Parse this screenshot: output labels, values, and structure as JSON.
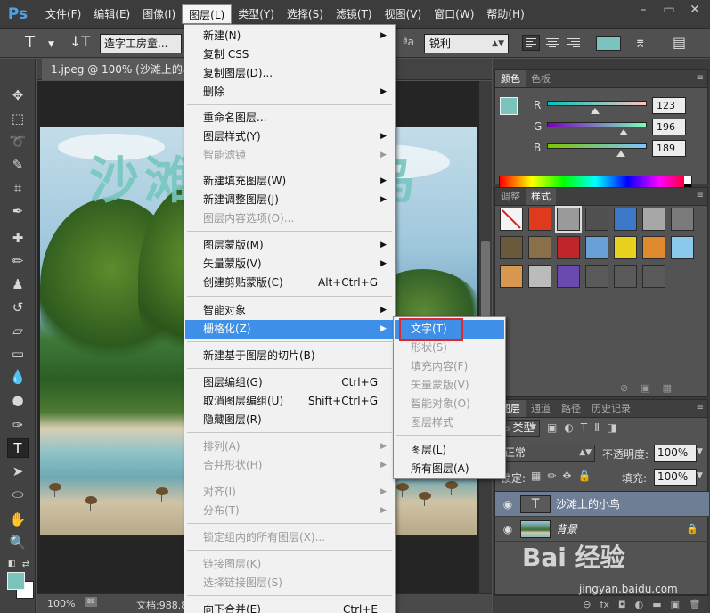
{
  "app": {
    "logo": "Ps"
  },
  "menubar": {
    "items": [
      "文件(F)",
      "编辑(E)",
      "图像(I)",
      "图层(L)",
      "类型(Y)",
      "选择(S)",
      "滤镜(T)",
      "视图(V)",
      "窗口(W)",
      "帮助(H)"
    ],
    "active": "图层(L)"
  },
  "window_controls": {
    "minimize": "–",
    "restore": "▭",
    "close": "✕"
  },
  "options_bar": {
    "tool_glyph": "T",
    "font_family": "造字工房童...",
    "aa_label": "ªa",
    "antialias": "锐利",
    "text_color": "#7bc4bd"
  },
  "document": {
    "tab_title": "1.jpeg @ 100% (沙滩上的小",
    "canvas_text": "沙滩上的小鸟",
    "zoom": "100%",
    "doc_info": "文档:988.8"
  },
  "layer_menu": {
    "items": [
      {
        "label": "新建(N)",
        "arrow": true
      },
      {
        "label": "复制 CSS"
      },
      {
        "label": "复制图层(D)..."
      },
      {
        "label": "删除",
        "arrow": true
      },
      {
        "label": "重命名图层..."
      },
      {
        "label": "图层样式(Y)",
        "arrow": true
      },
      {
        "label": "智能滤镜",
        "disabled": true,
        "arrow": true
      },
      {
        "label": "新建填充图层(W)",
        "arrow": true
      },
      {
        "label": "新建调整图层(J)",
        "arrow": true
      },
      {
        "label": "图层内容选项(O)...",
        "disabled": true
      },
      {
        "label": "图层蒙版(M)",
        "arrow": true
      },
      {
        "label": "矢量蒙版(V)",
        "arrow": true
      },
      {
        "label": "创建剪贴蒙版(C)",
        "shortcut": "Alt+Ctrl+G"
      },
      {
        "label": "智能对象",
        "arrow": true
      },
      {
        "label": "栅格化(Z)",
        "arrow": true,
        "highlighted": true
      },
      {
        "label": "新建基于图层的切片(B)"
      },
      {
        "label": "图层编组(G)",
        "shortcut": "Ctrl+G"
      },
      {
        "label": "取消图层编组(U)",
        "shortcut": "Shift+Ctrl+G"
      },
      {
        "label": "隐藏图层(R)"
      },
      {
        "label": "排列(A)",
        "disabled": true,
        "arrow": true
      },
      {
        "label": "合并形状(H)",
        "disabled": true,
        "arrow": true
      },
      {
        "label": "对齐(I)",
        "disabled": true,
        "arrow": true
      },
      {
        "label": "分布(T)",
        "disabled": true,
        "arrow": true
      },
      {
        "label": "锁定组内的所有图层(X)...",
        "disabled": true
      },
      {
        "label": "链接图层(K)",
        "disabled": true
      },
      {
        "label": "选择链接图层(S)",
        "disabled": true
      },
      {
        "label": "向下合并(E)",
        "shortcut": "Ctrl+E"
      }
    ]
  },
  "rasterize_submenu": {
    "items": [
      {
        "label": "文字(T)",
        "highlighted": true
      },
      {
        "label": "形状(S)",
        "disabled": true
      },
      {
        "label": "填充内容(F)",
        "disabled": true
      },
      {
        "label": "矢量蒙版(V)",
        "disabled": true
      },
      {
        "label": "智能对象(O)",
        "disabled": true
      },
      {
        "label": "图层样式",
        "disabled": true
      },
      {
        "label": "图层(L)"
      },
      {
        "label": "所有图层(A)"
      }
    ]
  },
  "color_panel": {
    "tabs": [
      "颜色",
      "色板"
    ],
    "active_tab": "颜色",
    "swatch_color": "#7bc4bd",
    "channels": [
      {
        "name": "R",
        "value": "123",
        "fraction": 0.482,
        "gradient": "linear-gradient(90deg,#00c4bd,#ffc4bd)"
      },
      {
        "name": "G",
        "value": "196",
        "fraction": 0.769,
        "gradient": "linear-gradient(90deg,#7b00bd,#7bffbd)"
      },
      {
        "name": "B",
        "value": "189",
        "fraction": 0.741,
        "gradient": "linear-gradient(90deg,#7bc400,#7bc4ff)"
      }
    ]
  },
  "styles_panel": {
    "tabs": [
      "调整",
      "样式"
    ],
    "active_tab": "样式",
    "styles": [
      {
        "icon": "none-style-icon",
        "color": "#f4f4f4"
      },
      {
        "icon": "red-glow-style-icon",
        "color": "#e03a1e"
      },
      {
        "icon": "gray-frame-style-icon",
        "color": "#9a9a9a"
      },
      {
        "icon": "dark-button-style-icon",
        "color": "#505050"
      },
      {
        "icon": "blue-cube-style-icon",
        "color": "#3c78c8"
      },
      {
        "icon": "gray-flat-style-icon",
        "color": "#a7a7a7"
      },
      {
        "icon": "gray-gradient-style-icon",
        "color": "#7a7a7a"
      },
      {
        "icon": "brown-style-icon",
        "color": "#6a5a3c"
      },
      {
        "icon": "tan-style-icon",
        "color": "#8a7048"
      },
      {
        "icon": "red-bar-style-icon",
        "color": "#c0252a"
      },
      {
        "icon": "rainbow-style-icon",
        "color": "#6aa0d8"
      },
      {
        "icon": "yellow-style-icon",
        "color": "#e8d21e"
      },
      {
        "icon": "orange-style-icon",
        "color": "#e08a30"
      },
      {
        "icon": "lightblue-style-icon",
        "color": "#8ac8ec"
      },
      {
        "icon": "sunset-style-icon",
        "color": "#d89850"
      },
      {
        "icon": "checker-style-icon",
        "color": "#bbbbbb"
      },
      {
        "icon": "purple-style-icon",
        "color": "#6a4ab0"
      },
      {
        "icon": "empty-style-icon",
        "color": "#5a5a5a"
      },
      {
        "icon": "empty-style-icon",
        "color": "#5a5a5a"
      },
      {
        "icon": "empty-style-icon",
        "color": "#5a5a5a"
      }
    ]
  },
  "layers_panel": {
    "tabs": [
      "图层",
      "通道",
      "路径",
      "历史记录"
    ],
    "active_tab": "图层",
    "filter_label": "类型",
    "blend_mode": "正常",
    "opacity_label": "不透明度:",
    "opacity_value": "100%",
    "lock_label": "锁定:",
    "fill_label": "填充:",
    "fill_value": "100%",
    "layers": [
      {
        "name": "沙滩上的小鸟",
        "kind": "text",
        "thumb_glyph": "T",
        "selected": true
      },
      {
        "name": "背景",
        "kind": "image",
        "locked": true
      }
    ],
    "footer_icons": [
      "link-icon",
      "fx-icon",
      "mask-icon",
      "adjustment-icon",
      "group-icon",
      "new-layer-icon",
      "trash-icon"
    ]
  },
  "watermark": {
    "brand": "Bai 经验",
    "url": "jingyan.baidu.com"
  }
}
